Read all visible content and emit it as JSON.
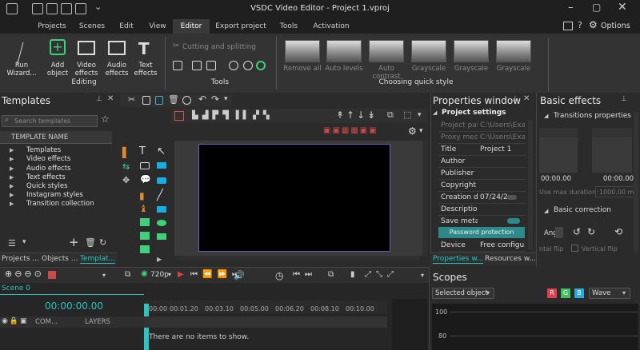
{
  "app": {
    "title": "VSDC Video Editor - Project 1.vproj",
    "options_label": "Options"
  },
  "tabs": [
    {
      "label": "Projects"
    },
    {
      "label": "Scenes"
    },
    {
      "label": "Edit"
    },
    {
      "label": "View"
    },
    {
      "label": "Editor"
    },
    {
      "label": "Export project"
    },
    {
      "label": "Tools"
    },
    {
      "label": "Activation"
    }
  ],
  "ribbon": {
    "run_wizard": "Run Wizard...",
    "add_object": "Add object",
    "video_effects": "Video effects",
    "audio_effects": "Audio effects",
    "text_effects": "Text effects",
    "editing_label": "Editing",
    "cutting_label": "Cutting and splitting",
    "tools_label": "Tools",
    "quick_styles": [
      "Remove all",
      "Auto levels",
      "Auto contrast",
      "Grayscale",
      "Grayscale",
      "Grayscale"
    ],
    "quick_style_label": "Choosing quick style"
  },
  "templates": {
    "title": "Templates",
    "search_placeholder": "Search templates",
    "column": "TEMPLATE NAME",
    "items": [
      "Templates",
      "Video effects",
      "Audio effects",
      "Text effects",
      "Quick styles",
      "Instagram styles",
      "Transition collection"
    ],
    "bottom_tabs": [
      "Projects ...",
      "Objects ...",
      "Templat..."
    ]
  },
  "properties": {
    "title": "Properties window",
    "section": "Project settings",
    "rows": [
      {
        "k": "Project path",
        "v": "C:\\Users\\Exam"
      },
      {
        "k": "Proxy media",
        "v": "C:\\Users\\Exa"
      },
      {
        "k": "Title",
        "v": "Project 1"
      },
      {
        "k": "Author",
        "v": ""
      },
      {
        "k": "Publisher",
        "v": ""
      },
      {
        "k": "Copyright",
        "v": ""
      },
      {
        "k": "Creation date",
        "v": "07/24/2"
      },
      {
        "k": "Description",
        "v": ""
      },
      {
        "k": "Save metadata",
        "v": ""
      }
    ],
    "password_btn": "Password protection",
    "device_k": "Device",
    "device_v": "Free configura",
    "bottom_tabs": [
      "Properties w...",
      "Resources w..."
    ]
  },
  "basic_effects": {
    "title": "Basic effects",
    "transitions": "Transitions properties",
    "time1": "00:00.00",
    "time2": "00:00.00",
    "max_duration_label": "Use max duration:",
    "max_duration_value": "1000.00 m",
    "basic_correction": "Basic correction",
    "angle_label": "Angl",
    "flip_h": "ntal flip",
    "flip_v": "Vertical flip"
  },
  "playback": {
    "resolution": "720p"
  },
  "timeline": {
    "scene_tab": "Scene 0",
    "time": "00:00:00.00",
    "ticks": [
      "00:00",
      "00:01.20",
      "00:03.10",
      "00:05.00",
      "00:06.20",
      "00:08.10",
      "00:10.00"
    ],
    "com_label": "COM...",
    "layers_label": "LAYERS",
    "empty_msg": "There are no items to show."
  },
  "scopes": {
    "title": "Scopes",
    "selected": "Selected object",
    "r": "R",
    "g": "G",
    "b": "B",
    "wave": "Wave",
    "scale_100": "100",
    "scale_80": "80"
  }
}
